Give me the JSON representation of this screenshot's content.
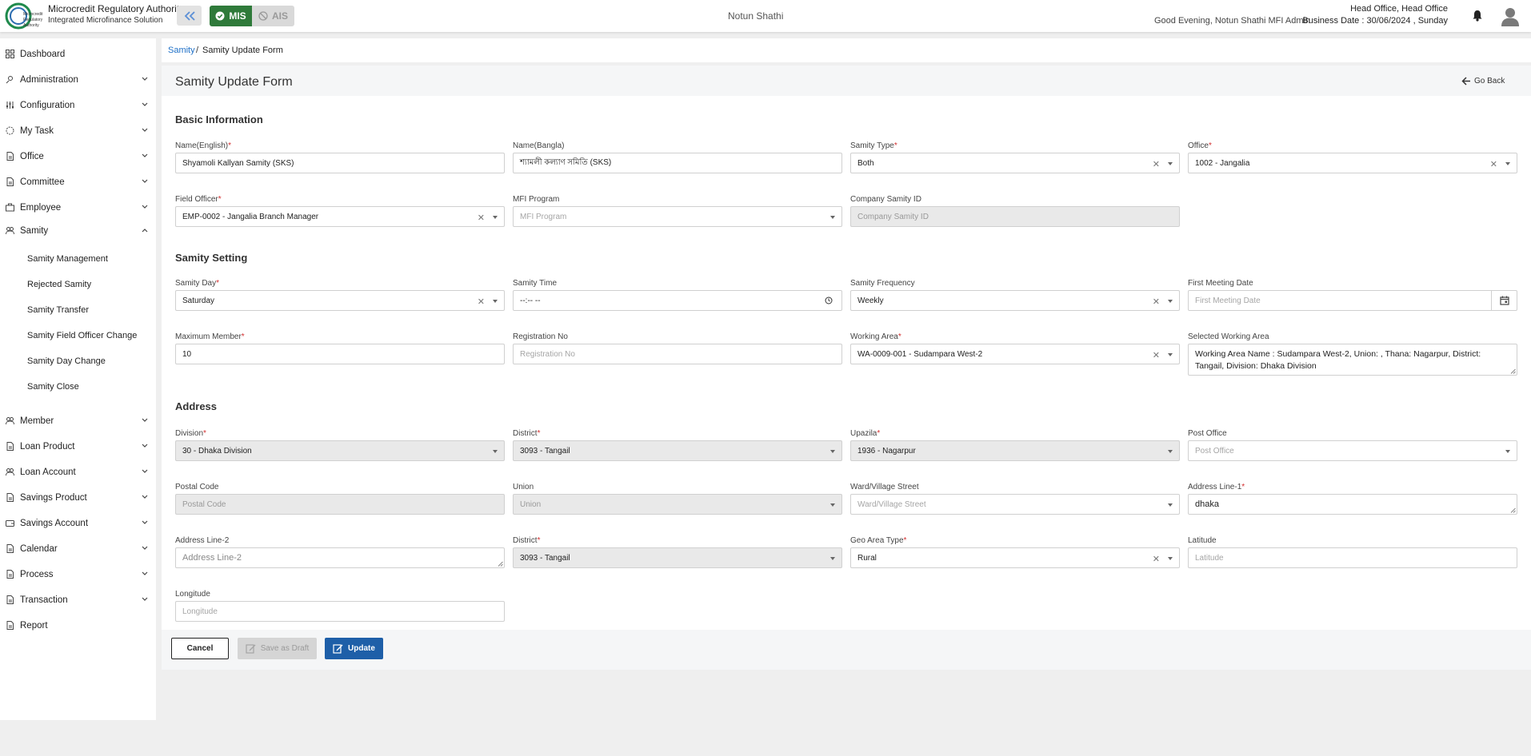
{
  "header": {
    "brand_title": "Microcredit Regulatory Authority",
    "brand_subtitle": "Integrated Microfinance Solution",
    "logo_text": "Microcredit Regulatory Authority",
    "mode_mis": "MIS",
    "mode_ais": "AIS",
    "org_name": "Notun Shathi",
    "greeting": "Good Evening, Notun Shathi MFI Admin",
    "office": "Head Office, Head Office",
    "business_date": "Business Date : 30/06/2024 , Sunday"
  },
  "sidebar": {
    "items": [
      {
        "label": "Dashboard"
      },
      {
        "label": "Administration"
      },
      {
        "label": "Configuration"
      },
      {
        "label": "My Task"
      },
      {
        "label": "Office"
      },
      {
        "label": "Committee"
      },
      {
        "label": "Employee"
      },
      {
        "label": "Samity"
      },
      {
        "label": "Member"
      },
      {
        "label": "Loan Product"
      },
      {
        "label": "Loan Account"
      },
      {
        "label": "Savings Product"
      },
      {
        "label": "Savings Account"
      },
      {
        "label": "Calendar"
      },
      {
        "label": "Process"
      },
      {
        "label": "Transaction"
      },
      {
        "label": "Report"
      }
    ],
    "samity_sub": [
      "Samity Management",
      "Rejected Samity",
      "Samity Transfer",
      "Samity Field Officer Change",
      "Samity Day Change",
      "Samity Close"
    ]
  },
  "breadcrumb": {
    "parent": "Samity",
    "sep": "/",
    "current": "Samity Update Form"
  },
  "page": {
    "title": "Samity Update Form",
    "go_back": "Go Back"
  },
  "sections": {
    "basic": "Basic Information",
    "setting": "Samity Setting",
    "address": "Address"
  },
  "fields": {
    "name_en": {
      "label": "Name(English)",
      "value": "Shyamoli Kallyan Samity (SKS)"
    },
    "name_bn": {
      "label": "Name(Bangla)",
      "value": "শ্যামলী কল্যাণ সমিতি (SKS)"
    },
    "samity_type": {
      "label": "Samity Type",
      "value": "Both"
    },
    "office": {
      "label": "Office",
      "value": "1002 - Jangalia"
    },
    "field_officer": {
      "label": "Field Officer",
      "value": "EMP-0002 - Jangalia Branch Manager"
    },
    "mfi_program": {
      "label": "MFI Program",
      "placeholder": "MFI Program"
    },
    "company_samity_id": {
      "label": "Company Samity ID",
      "placeholder": "Company Samity ID"
    },
    "samity_day": {
      "label": "Samity Day",
      "value": "Saturday"
    },
    "samity_time": {
      "label": "Samity Time",
      "value": "--:-- --"
    },
    "samity_frequency": {
      "label": "Samity Frequency",
      "value": "Weekly"
    },
    "first_meeting_date": {
      "label": "First Meeting Date",
      "placeholder": "First Meeting Date"
    },
    "maximum_member": {
      "label": "Maximum Member",
      "value": "10"
    },
    "registration_no": {
      "label": "Registration No",
      "placeholder": "Registration No"
    },
    "working_area": {
      "label": "Working Area",
      "value": "WA-0009-001 - Sudampara West-2"
    },
    "selected_working_area": {
      "label": "Selected Working Area",
      "value": "Working Area Name : Sudampara West-2, Union: , Thana:  Nagarpur, District: Tangail, Division: Dhaka Division"
    },
    "division": {
      "label": "Division",
      "value": "30 - Dhaka Division"
    },
    "district": {
      "label": "District",
      "value": "3093 - Tangail"
    },
    "upazila": {
      "label": "Upazila",
      "value": "1936 - Nagarpur"
    },
    "post_office": {
      "label": "Post Office",
      "placeholder": "Post Office"
    },
    "postal_code": {
      "label": "Postal Code",
      "placeholder": "Postal Code"
    },
    "union": {
      "label": "Union",
      "placeholder": "Union"
    },
    "ward": {
      "label": "Ward/Village Street",
      "placeholder": "Ward/Village Street"
    },
    "address_line1": {
      "label": "Address Line-1",
      "value": "dhaka"
    },
    "address_line2": {
      "label": "Address Line-2",
      "placeholder": "Address Line-2"
    },
    "district2": {
      "label": "District",
      "value": "3093 - Tangail"
    },
    "geo_area_type": {
      "label": "Geo Area Type",
      "value": "Rural"
    },
    "latitude": {
      "label": "Latitude",
      "placeholder": "Latitude"
    },
    "longitude": {
      "label": "Longitude",
      "placeholder": "Longitude"
    }
  },
  "buttons": {
    "cancel": "Cancel",
    "save_draft": "Save as Draft",
    "update": "Update"
  },
  "colors": {
    "primary": "#1e5fa8",
    "mis_green": "#2f7a3a",
    "link": "#1e70c7",
    "required": "#d32f2f"
  }
}
